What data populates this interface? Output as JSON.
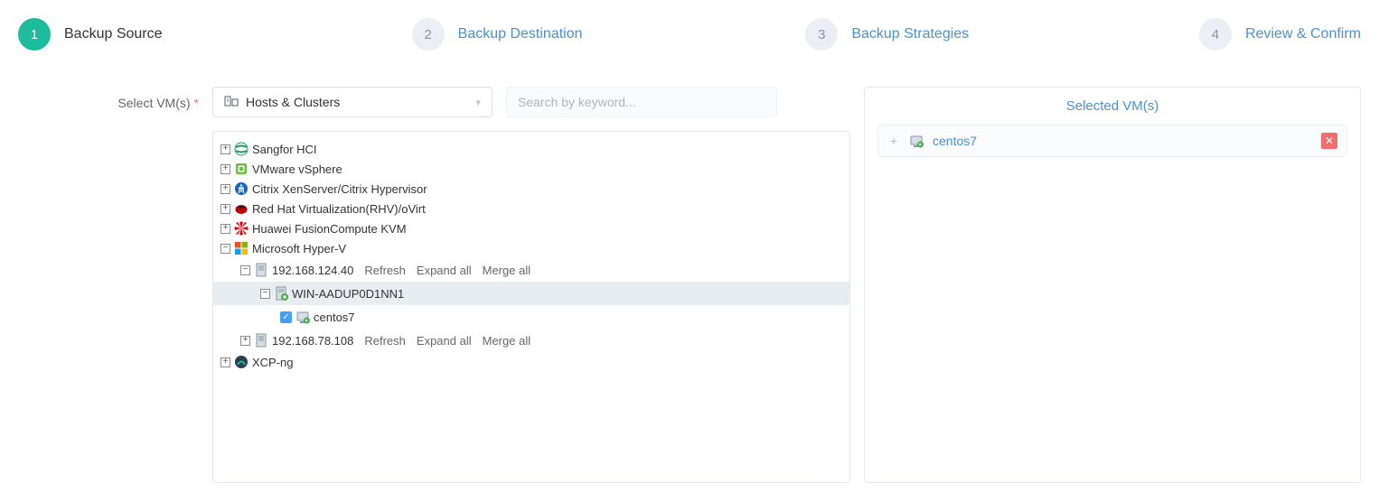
{
  "stepper": {
    "steps": [
      {
        "num": "1",
        "label": "Backup Source",
        "active": true
      },
      {
        "num": "2",
        "label": "Backup Destination",
        "active": false
      },
      {
        "num": "3",
        "label": "Backup Strategies",
        "active": false
      },
      {
        "num": "4",
        "label": "Review & Confirm",
        "active": false
      }
    ]
  },
  "form": {
    "select_vms_label": "Select VM(s)",
    "view_selector": "Hosts & Clusters",
    "search_placeholder": "Search by keyword..."
  },
  "tree": {
    "roots": [
      {
        "label": "Sangfor HCI",
        "icon": "sangfor",
        "expanded": false
      },
      {
        "label": "VMware vSphere",
        "icon": "vmware",
        "expanded": false
      },
      {
        "label": "Citrix XenServer/Citrix Hypervisor",
        "icon": "citrix",
        "expanded": false
      },
      {
        "label": "Red Hat Virtualization(RHV)/oVirt",
        "icon": "redhat",
        "expanded": false
      },
      {
        "label": "Huawei FusionCompute KVM",
        "icon": "huawei",
        "expanded": false
      },
      {
        "label": "Microsoft Hyper-V",
        "icon": "hyperv",
        "expanded": true
      },
      {
        "label": "XCP-ng",
        "icon": "xcpng",
        "expanded": false
      }
    ],
    "hyperv_hosts": [
      {
        "label": "192.168.124.40",
        "expanded": true,
        "actions": {
          "refresh": "Refresh",
          "expand_all": "Expand all",
          "merge_all": "Merge all"
        },
        "children": [
          {
            "label": "WIN-AADUP0D1NN1",
            "expanded": true,
            "selected_row": true,
            "children": [
              {
                "label": "centos7",
                "checked": true
              }
            ]
          }
        ]
      },
      {
        "label": "192.168.78.108",
        "expanded": false,
        "actions": {
          "refresh": "Refresh",
          "expand_all": "Expand all",
          "merge_all": "Merge all"
        }
      }
    ]
  },
  "selected_panel": {
    "title": "Selected VM(s)",
    "items": [
      {
        "label": "centos7"
      }
    ]
  }
}
